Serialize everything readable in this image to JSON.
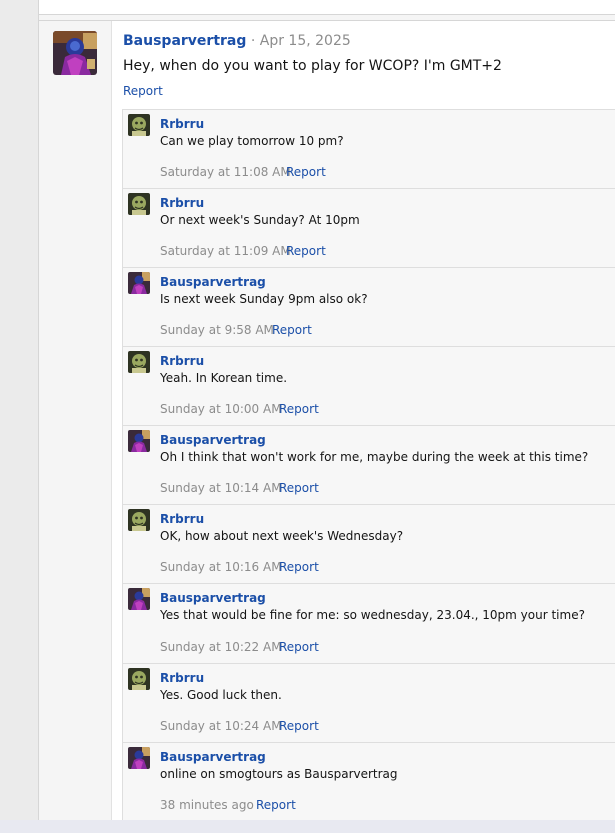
{
  "post": {
    "author": "Bausparvertrag",
    "separator": "·",
    "date": "Apr 15, 2025",
    "text": "Hey, when do you want to play for WCOP? I'm GMT+2",
    "report_label": "Report",
    "avatar_icon": "user-avatar-icon"
  },
  "comments": [
    {
      "author": "Rrbrru",
      "text": "Can we play tomorrow 10 pm?",
      "time": "Saturday at 11:08 AM",
      "report": "Report"
    },
    {
      "author": "Rrbrru",
      "text": "Or next week's Sunday? At 10pm",
      "time": "Saturday at 11:09 AM",
      "report": "Report"
    },
    {
      "author": "Bausparvertrag",
      "text": "Is next week Sunday 9pm also ok?",
      "time": "Sunday at 9:58 AM",
      "report": "Report"
    },
    {
      "author": "Rrbrru",
      "text": "Yeah. In Korean time.",
      "time": "Sunday at 10:00 AM",
      "report": "Report"
    },
    {
      "author": "Bausparvertrag",
      "text": "Oh I think that won't work for me, maybe during the week at this time?",
      "time": "Sunday at 10:14 AM",
      "report": "Report"
    },
    {
      "author": "Rrbrru",
      "text": "OK, how about next week's Wednesday?",
      "time": "Sunday at 10:16 AM",
      "report": "Report"
    },
    {
      "author": "Bausparvertrag",
      "text": "Yes that would be fine for me: so wednesday, 23.04., 10pm your time?",
      "time": "Sunday at 10:22 AM",
      "report": "Report"
    },
    {
      "author": "Rrbrru",
      "text": "Yes. Good luck then.",
      "time": "Sunday at 10:24 AM",
      "report": "Report"
    },
    {
      "author": "Bausparvertrag",
      "text": "online on smogtours as Bausparvertrag",
      "time": "38 minutes ago",
      "report": "Report"
    }
  ],
  "colors": {
    "link": "#1b4fa8",
    "muted": "#8c8c8c",
    "text": "#141414"
  }
}
